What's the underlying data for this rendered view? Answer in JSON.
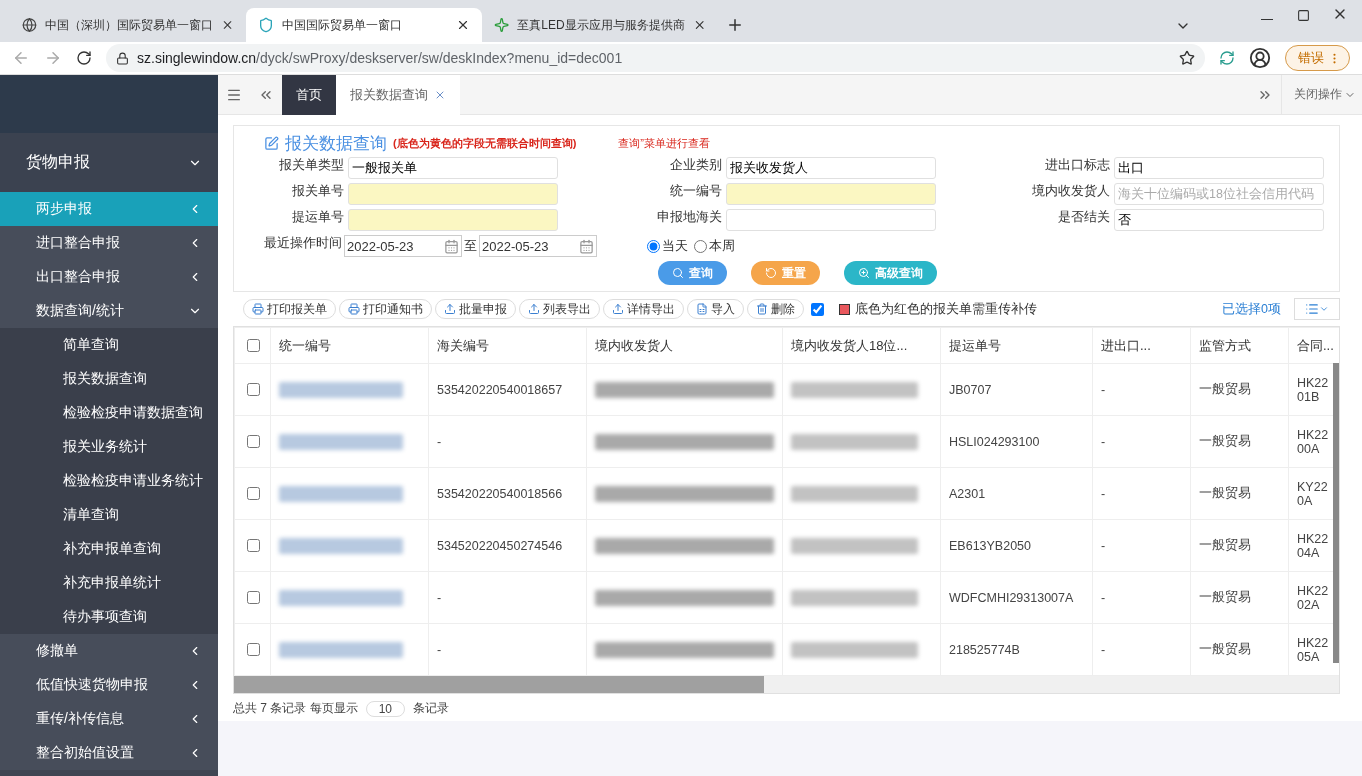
{
  "browser": {
    "tabs": [
      {
        "title": "中国（深圳）国际贸易单一窗口",
        "selected": false,
        "kind": "globe"
      },
      {
        "title": "中国国际贸易单一窗口",
        "selected": true,
        "kind": "shield"
      },
      {
        "title": "至真LED显示应用与服务提供商",
        "selected": false,
        "kind": "star"
      }
    ],
    "url_host": "sz.singlewindow.cn",
    "url_path": "/dyck/swProxy/deskserver/sw/deskIndex?menu_id=dec001",
    "error_label": "错误"
  },
  "sidebar": {
    "items": [
      {
        "label": "货物申报",
        "expanded": true,
        "children": [
          {
            "label": "两步申报",
            "selected": true,
            "expanded": false
          },
          {
            "label": "进口整合申报",
            "selected": false,
            "expanded": false
          },
          {
            "label": "出口整合申报",
            "selected": false,
            "expanded": false
          },
          {
            "label": "数据查询/统计",
            "selected": false,
            "expanded": true,
            "children": [
              {
                "label": "简单查询",
                "selected": false
              },
              {
                "label": "报关数据查询",
                "selected": false
              },
              {
                "label": "检验检疫申请数据查询",
                "selected": false
              },
              {
                "label": "报关业务统计",
                "selected": false
              },
              {
                "label": "检验检疫申请业务统计",
                "selected": false
              },
              {
                "label": "清单查询",
                "selected": false
              },
              {
                "label": "补充申报单查询",
                "selected": false
              },
              {
                "label": "补充申报单统计",
                "selected": false
              },
              {
                "label": "待办事项查询",
                "selected": false
              }
            ]
          },
          {
            "label": "修撤单",
            "selected": false,
            "expanded": false
          },
          {
            "label": "低值快速货物申报",
            "selected": false,
            "expanded": false
          },
          {
            "label": "重传/补传信息",
            "selected": false,
            "expanded": false
          },
          {
            "label": "整合初始值设置",
            "selected": false,
            "expanded": false
          }
        ]
      }
    ]
  },
  "page_tabs": [
    {
      "label": "首页",
      "selected": true,
      "closable": false
    },
    {
      "label": "报关数据查询",
      "selected": false,
      "closable": true
    }
  ],
  "close_ops": "关闭操作",
  "form": {
    "title": "报关数据查询",
    "note": "(底色为黄色的字段无需联合时间查询)",
    "hint": "查询”菜单进行查看",
    "fields": [
      {
        "label": "报关单类型",
        "value": "一般报关单",
        "highlight": false
      },
      {
        "label": "企业类别",
        "value": "报关收发货人",
        "highlight": false
      },
      {
        "label": "进出口标志",
        "value": "出口",
        "highlight": false
      },
      {
        "label": "报关单号",
        "highlight": true
      },
      {
        "label": "统一编号",
        "highlight": true
      },
      {
        "label": "境内收发货人",
        "placeholder": "海关十位编码或18位社会信用代码",
        "highlight": false
      },
      {
        "label": "提运单号",
        "highlight": true
      },
      {
        "label": "申报地海关",
        "highlight": false
      },
      {
        "label": "是否结关",
        "value": "否",
        "highlight": false
      }
    ],
    "date_label": "最近操作时间",
    "date_from": "2022-05-23",
    "date_sep": "至",
    "date_to": "2022-05-23",
    "ranges": [
      {
        "label": "当天",
        "selected": true
      },
      {
        "label": "本周",
        "selected": false
      }
    ],
    "buttons": [
      {
        "label": "查询",
        "kind": "search"
      },
      {
        "label": "重置",
        "kind": "reset"
      },
      {
        "label": "高级查询",
        "kind": "advanced"
      }
    ]
  },
  "toolbar": {
    "buttons": [
      {
        "label": "打印报关单",
        "kind": "print"
      },
      {
        "label": "打印通知书",
        "kind": "print"
      },
      {
        "label": "批量申报",
        "kind": "upload"
      },
      {
        "label": "列表导出",
        "kind": "upload"
      },
      {
        "label": "详情导出",
        "kind": "upload"
      },
      {
        "label": "导入",
        "kind": "excel"
      },
      {
        "label": "删除",
        "kind": "trash"
      }
    ],
    "checked": true,
    "legend": "底色为红色的报关单需重传补传",
    "selected_count": "已选择0项"
  },
  "table": {
    "all_checked": false,
    "columns": [
      "统一编号",
      "海关编号",
      "境内收发货人",
      "境内收发货人18位...",
      "提运单号",
      "进出口...",
      "监管方式",
      "合同..."
    ],
    "rows": [
      {
        "checked": false,
        "customs_no": "535420220540018657",
        "bill_no": "JB0707",
        "io": "-",
        "mode": "一般贸易",
        "contract": "HK2201B"
      },
      {
        "checked": false,
        "customs_no": "-",
        "bill_no": "HSLI024293100",
        "io": "-",
        "mode": "一般贸易",
        "contract": "HK2200A"
      },
      {
        "checked": false,
        "customs_no": "535420220540018566",
        "bill_no": "A2301",
        "io": "-",
        "mode": "一般贸易",
        "contract": "KY220A"
      },
      {
        "checked": false,
        "customs_no": "534520220450274546",
        "bill_no": "EB613YB2050",
        "io": "-",
        "mode": "一般贸易",
        "contract": "HK2204A"
      },
      {
        "checked": false,
        "customs_no": "-",
        "bill_no": "WDFCMHI29313007A",
        "io": "-",
        "mode": "一般贸易",
        "contract": "HK2202A"
      },
      {
        "checked": false,
        "customs_no": "-",
        "bill_no": "218525774B",
        "io": "-",
        "mode": "一般贸易",
        "contract": "HK2205A"
      }
    ]
  },
  "pager": {
    "prefix": "总共 7 条记录 每页显示",
    "size": "10",
    "suffix": "条记录"
  }
}
